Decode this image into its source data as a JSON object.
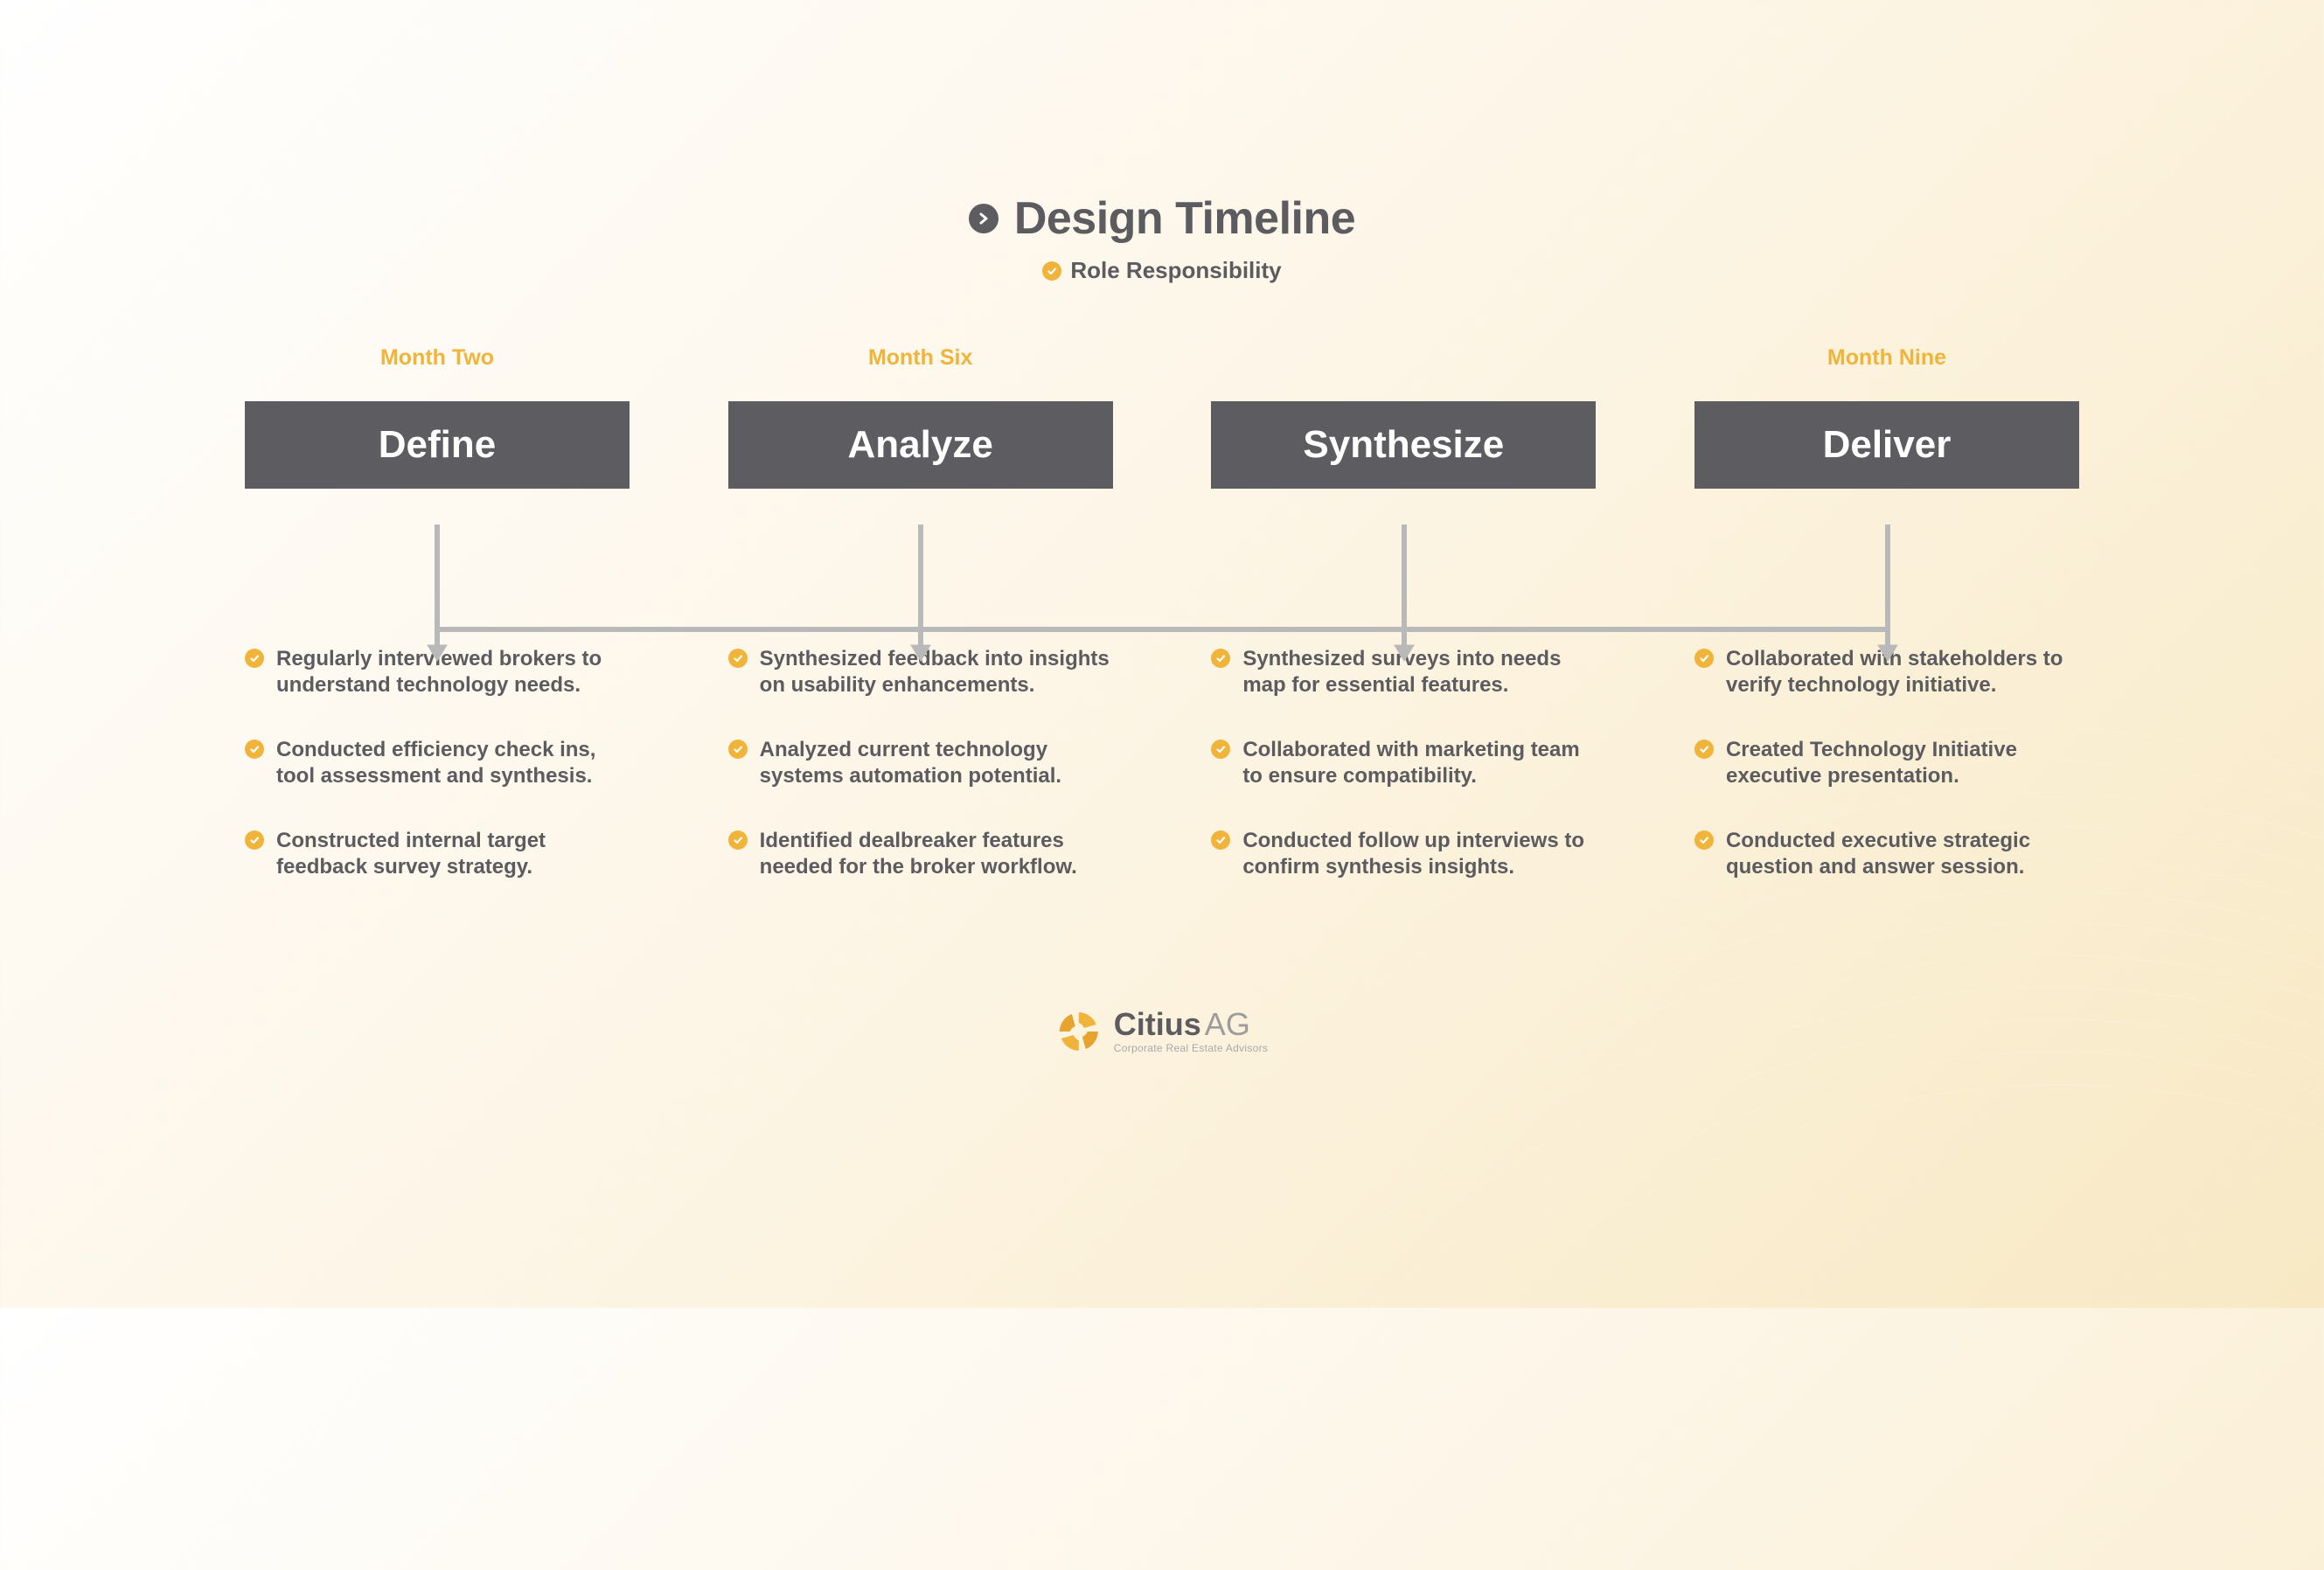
{
  "title": "Design Timeline",
  "subtitle": "Role Responsibility",
  "months": [
    "Month Two",
    "",
    "Month Six",
    "",
    "",
    "Month Nine",
    ""
  ],
  "columns": [
    {
      "month": "Month Two",
      "stage": "Define",
      "bullets": [
        "Regularly interviewed brokers to understand technology needs.",
        "Conducted efficiency check ins, tool assessment and synthesis.",
        "Constructed internal target feedback survey strategy."
      ]
    },
    {
      "month": "Month Six",
      "stage": "Analyze",
      "bullets": [
        "Synthesized feedback into insights on usability enhancements.",
        "Analyzed current technology systems automation potential.",
        "Identified dealbreaker features needed for the broker workflow."
      ]
    },
    {
      "month": "",
      "stage": "Synthesize",
      "bullets": [
        "Synthesized surveys into needs map for essential features.",
        "Collaborated with marketing team to ensure compatibility.",
        "Conducted follow up interviews to confirm synthesis insights."
      ]
    },
    {
      "month": "Month Nine",
      "stage": "Deliver",
      "bullets": [
        "Collaborated with stakeholders to verify technology initiative.",
        "Created Technology Initiative executive presentation.",
        "Conducted executive strategic question and answer session."
      ]
    }
  ],
  "logo": {
    "name": "Citius",
    "suffix": "AG",
    "tagline": "Corporate Real Estate Advisors"
  }
}
